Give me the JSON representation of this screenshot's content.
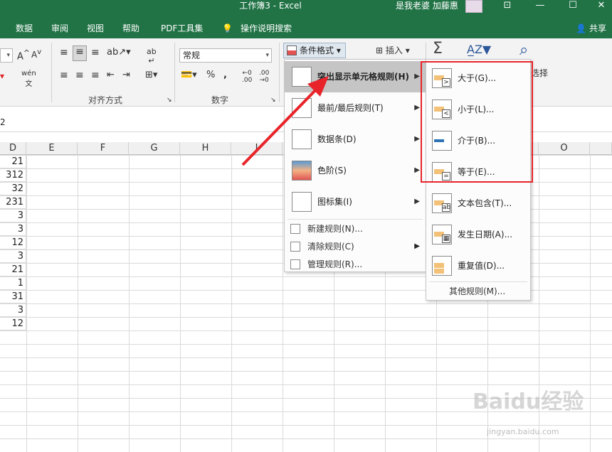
{
  "window": {
    "title": "工作簿3  -  Excel",
    "user": "是我老婆 加藤惠",
    "buttons": {
      "ribbon_display": "⊡",
      "minimize": "—",
      "maximize": "☐",
      "close": "✕"
    }
  },
  "tabs": [
    "数据",
    "审阅",
    "视图",
    "帮助",
    "PDF工具集",
    "操作说明搜索"
  ],
  "share_label": "共享",
  "ribbon": {
    "alignment_group": "对齐方式",
    "number_group": "数字",
    "number_format": "常规",
    "percent": "%",
    "comma": ",",
    "conditional_format": "条件格式",
    "insert": "插入",
    "sum_symbol": "Σ",
    "select_fragment": "选择"
  },
  "formula": {
    "name_box_fragment": "2"
  },
  "grid": {
    "columns": [
      "D",
      "E",
      "F",
      "G",
      "H",
      "I",
      "O"
    ],
    "values": [
      "21",
      "312",
      "32",
      "231",
      "3",
      "3",
      "12",
      "3",
      "21",
      "1",
      "31",
      "3",
      "12"
    ]
  },
  "menu": {
    "items": [
      {
        "label": "突出显示单元格规则(H)",
        "icon": "highlight-cells-icon",
        "highlighted": true
      },
      {
        "label": "最前/最后规则(T)",
        "icon": "top-bottom-icon"
      },
      {
        "label": "数据条(D)",
        "icon": "data-bars-icon"
      },
      {
        "label": "色阶(S)",
        "icon": "color-scale-icon"
      },
      {
        "label": "图标集(I)",
        "icon": "icon-sets-icon"
      }
    ],
    "small_items": [
      {
        "label": "新建规则(N)...",
        "icon": "new-rule-icon"
      },
      {
        "label": "清除规则(C)",
        "icon": "clear-rule-icon"
      },
      {
        "label": "管理规则(R)...",
        "icon": "manage-rules-icon"
      }
    ]
  },
  "submenu": {
    "items": [
      {
        "label": "大于(G)...",
        "mark": ">"
      },
      {
        "label": "小于(L)...",
        "mark": "<"
      },
      {
        "label": "介于(B)...",
        "mark": ""
      },
      {
        "label": "等于(E)...",
        "mark": "="
      },
      {
        "label": "文本包含(T)...",
        "mark": "ab"
      },
      {
        "label": "发生日期(A)...",
        "mark": "▦"
      },
      {
        "label": "重复值(D)...",
        "mark": ""
      }
    ],
    "more": "其他规则(M)..."
  },
  "watermark": {
    "main": "Baidu经验",
    "sub": "jingyan.baidu.com"
  },
  "colors": {
    "brand": "#217346",
    "highlight_box": "#e8242a",
    "menu_highlight": "#c5c5c5"
  }
}
